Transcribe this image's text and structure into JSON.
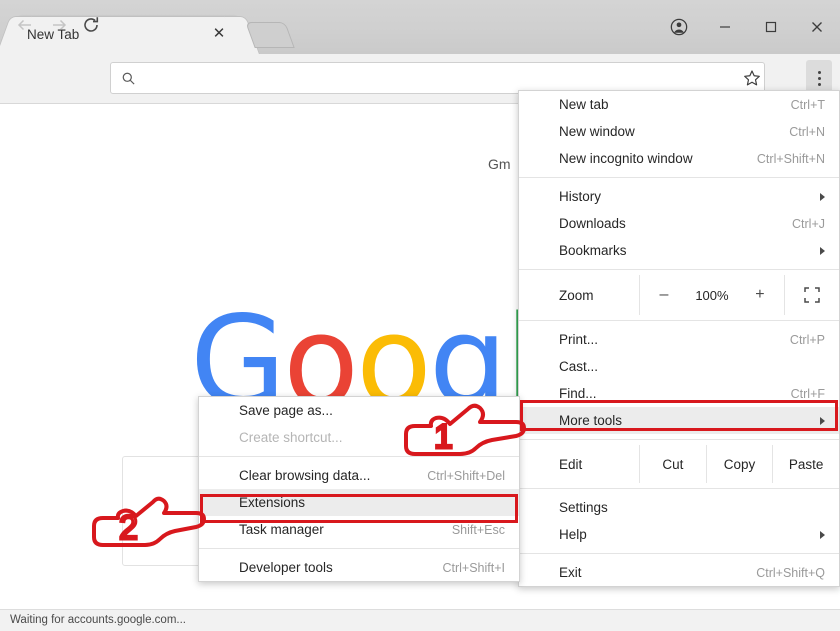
{
  "window": {
    "tab_title": "New Tab",
    "close_tab_icon": "close-icon",
    "new_tab_button_icon": "new-tab-icon",
    "controls": [
      {
        "name": "profile-avatar",
        "icon": "account-circle-icon"
      },
      {
        "name": "minimize",
        "icon": "minimize-icon"
      },
      {
        "name": "maximize",
        "icon": "maximize-icon"
      },
      {
        "name": "close",
        "icon": "close-icon"
      }
    ]
  },
  "toolbar": {
    "back_icon": "back-arrow-icon",
    "forward_icon": "forward-arrow-icon",
    "reload_icon": "reload-icon",
    "search_icon": "search-icon",
    "omnibox_value": "",
    "omnibox_placeholder": "",
    "bookmark_icon": "star-icon",
    "menu_icon": "three-dot-menu-icon"
  },
  "page": {
    "gmail_link": "Gm",
    "logo_letters": [
      {
        "char": "G",
        "color": "#4285F4"
      },
      {
        "char": "o",
        "color": "#EA4335"
      },
      {
        "char": "o",
        "color": "#FBBC05"
      },
      {
        "char": "g",
        "color": "#4285F4"
      },
      {
        "char": "l",
        "color": "#34A853"
      }
    ],
    "status_text": "Waiting for accounts.google.com..."
  },
  "main_menu": {
    "groups": [
      {
        "items": [
          {
            "label": "New tab",
            "accel": "Ctrl+T",
            "name": "menu-item-new-tab"
          },
          {
            "label": "New window",
            "accel": "Ctrl+N",
            "name": "menu-item-new-window"
          },
          {
            "label": "New incognito window",
            "accel": "Ctrl+Shift+N",
            "name": "menu-item-new-incognito-window"
          }
        ]
      },
      {
        "items": [
          {
            "label": "History",
            "accel": "",
            "submenu": true,
            "name": "menu-item-history"
          },
          {
            "label": "Downloads",
            "accel": "Ctrl+J",
            "name": "menu-item-downloads"
          },
          {
            "label": "Bookmarks",
            "accel": "",
            "submenu": true,
            "name": "menu-item-bookmarks"
          }
        ]
      }
    ],
    "zoom": {
      "label": "Zoom",
      "minus": "–",
      "value": "100%",
      "plus": "+",
      "fullscreen_icon": "fullscreen-icon"
    },
    "tools_group": [
      {
        "label": "Print...",
        "accel": "Ctrl+P",
        "name": "menu-item-print"
      },
      {
        "label": "Cast...",
        "accel": "",
        "name": "menu-item-cast"
      },
      {
        "label": "Find...",
        "accel": "Ctrl+F",
        "name": "menu-item-find"
      },
      {
        "label": "More tools",
        "accel": "",
        "submenu": true,
        "highlighted": true,
        "name": "menu-item-more-tools"
      }
    ],
    "edit_row": {
      "label": "Edit",
      "cut": "Cut",
      "copy": "Copy",
      "paste": "Paste"
    },
    "settings_group": [
      {
        "label": "Settings",
        "accel": "",
        "name": "menu-item-settings"
      },
      {
        "label": "Help",
        "accel": "",
        "submenu": true,
        "name": "menu-item-help"
      }
    ],
    "exit_group": [
      {
        "label": "Exit",
        "accel": "Ctrl+Shift+Q",
        "name": "menu-item-exit"
      }
    ]
  },
  "sub_menu": {
    "group1": [
      {
        "label": "Save page as...",
        "accel": "",
        "name": "submenu-item-save-page-as"
      },
      {
        "label": "Create shortcut...",
        "accel": "",
        "disabled": true,
        "name": "submenu-item-create-shortcut"
      }
    ],
    "group2": [
      {
        "label": "Clear browsing data...",
        "accel": "Ctrl+Shift+Del",
        "name": "submenu-item-clear-browsing-data"
      },
      {
        "label": "Extensions",
        "accel": "",
        "highlighted": true,
        "name": "submenu-item-extensions"
      },
      {
        "label": "Task manager",
        "accel": "Shift+Esc",
        "name": "submenu-item-task-manager"
      }
    ],
    "group3": [
      {
        "label": "Developer tools",
        "accel": "Ctrl+Shift+I",
        "name": "submenu-item-developer-tools"
      }
    ]
  },
  "annotations": {
    "hand1_number": "1",
    "hand2_number": "2",
    "accent_color": "#d8181d"
  }
}
